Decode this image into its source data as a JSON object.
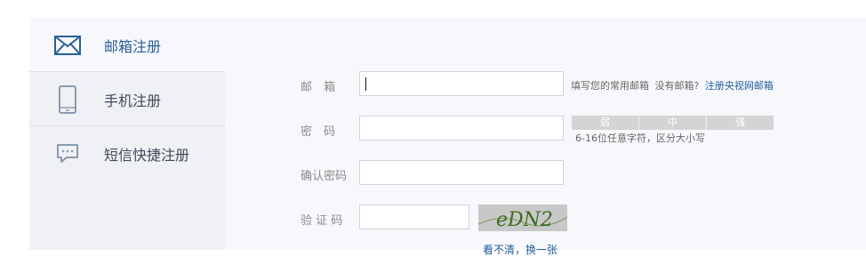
{
  "sidebar": {
    "items": [
      {
        "label": "邮箱注册",
        "icon": "envelope-icon"
      },
      {
        "label": "手机注册",
        "icon": "phone-icon"
      },
      {
        "label": "短信快捷注册",
        "icon": "sms-icon"
      }
    ]
  },
  "form": {
    "email": {
      "label": "邮　箱",
      "value": "",
      "hint": "填写您的常用邮箱",
      "no_email": "没有邮箱?",
      "register_link": "注册央视网邮箱"
    },
    "password": {
      "label": "密　码",
      "value": "",
      "strength_levels": [
        "弱",
        "中",
        "强"
      ],
      "hint": "6-16位任意字符，区分大小写"
    },
    "confirm_password": {
      "label": "确认密码",
      "value": ""
    },
    "captcha": {
      "label": "验 证 码",
      "value": "",
      "image_text": "eDN2",
      "refresh_link": "看不清，换一张"
    }
  },
  "colors": {
    "accent": "#2a5e97",
    "link": "#1f5c9c",
    "sidebar_bg": "#f0f1f4",
    "panel_bg": "#f7f8fb"
  }
}
